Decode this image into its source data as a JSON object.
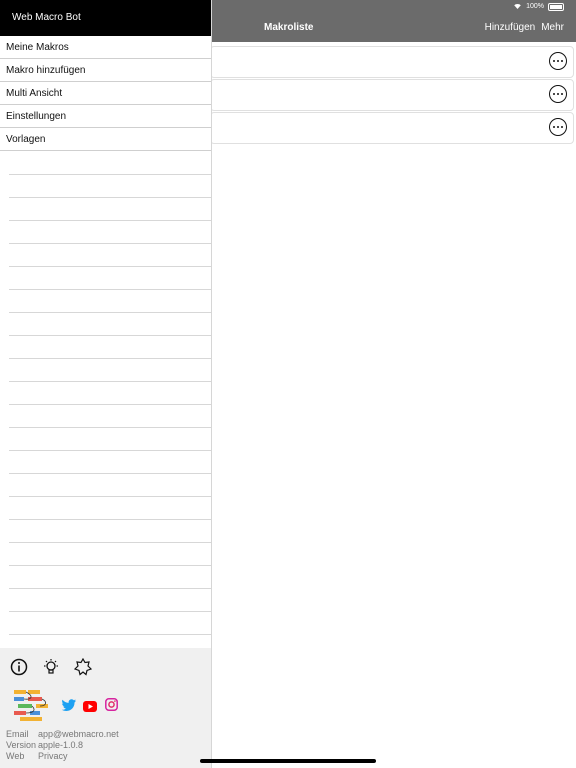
{
  "status_bar": {
    "battery_text": "100%"
  },
  "navbar": {
    "title": "Makroliste",
    "add_label": "Hinzufügen",
    "more_label": "Mehr"
  },
  "macro_list": {
    "row_count": 3
  },
  "drawer": {
    "title": "Web Macro Bot",
    "menu_items": [
      {
        "label": "Meine Makros"
      },
      {
        "label": "Makro hinzufügen"
      },
      {
        "label": "Multi Ansicht"
      },
      {
        "label": "Einstellungen"
      },
      {
        "label": "Vorlagen"
      }
    ],
    "footer": {
      "icons": [
        "info-icon",
        "lightbulb-icon",
        "badge-icon",
        "app-logo",
        "twitter-icon",
        "youtube-icon",
        "instagram-icon"
      ],
      "email_label": "Email",
      "email_value": "app@webmacro.net",
      "version_label": "Version",
      "version_value": "apple-1.0.8",
      "web_label": "Web",
      "web_value": "Privacy"
    }
  },
  "colors": {
    "navbar": "#6b6b6b",
    "drawer_header": "#000000",
    "footer_bg": "#f0f0f0",
    "twitter": "#1da1f2",
    "youtube": "#ff0000"
  }
}
